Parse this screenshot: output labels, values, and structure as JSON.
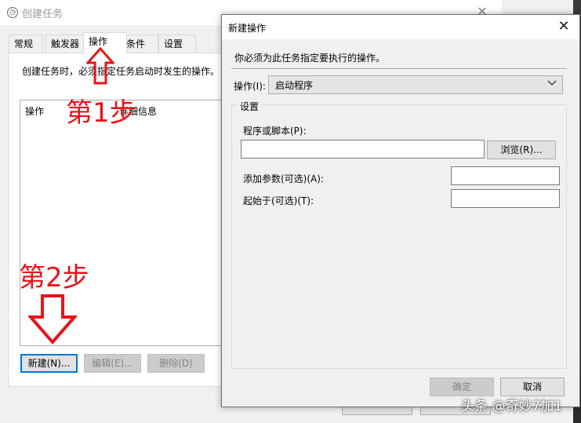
{
  "background_window": {
    "title": "创建任务",
    "tabs": [
      {
        "label": "常规"
      },
      {
        "label": "触发器"
      },
      {
        "label": "操作"
      },
      {
        "label": "条件"
      },
      {
        "label": "设置"
      }
    ],
    "description": "创建任务时，必须指定任务启动时发生的操作。",
    "columns": [
      "操作",
      "详细信息"
    ],
    "buttons": {
      "new": "新建(N)...",
      "edit": "编辑(E)...",
      "delete": "删除(D)"
    }
  },
  "dialog": {
    "title": "新建操作",
    "instruction": "你必须为此任务指定要执行的操作。",
    "action_label": "操作(I):",
    "action_value": "启动程序",
    "settings_group": "设置",
    "program_label": "程序或脚本(P):",
    "program_value": "",
    "browse_button": "浏览(R)...",
    "args_label": "添加参数(可选)(A):",
    "args_value": "",
    "start_in_label": "起始于(可选)(T):",
    "start_in_value": "",
    "ok_button": "确定",
    "cancel_button": "取消"
  },
  "annotations": {
    "step1": "第1步",
    "step2": "第2步",
    "color": "#e8141a"
  },
  "watermark": "头条 @奇妙7加1",
  "icons": {
    "window": "clock-icon",
    "close": "close-icon",
    "dropdown": "chevron-down-icon"
  }
}
